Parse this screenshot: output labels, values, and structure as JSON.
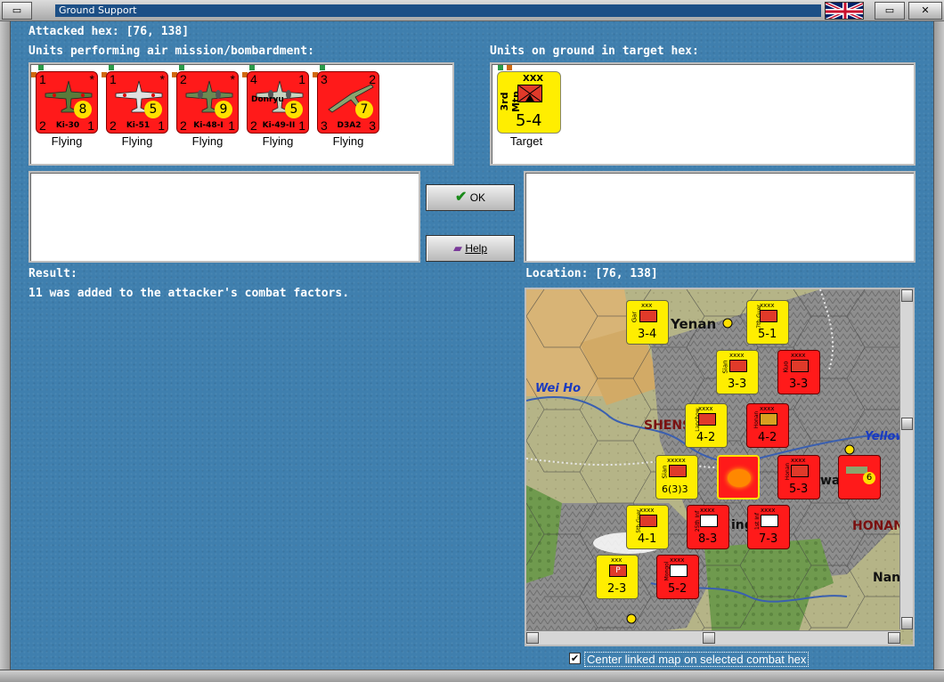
{
  "window": {
    "title": "Ground Support"
  },
  "attacked_hex_label": "Attacked hex:",
  "attacked_hex_value": "[76, 138]",
  "air_units_heading": "Units performing air mission/bombardment:",
  "ground_units_heading": "Units on ground in target hex:",
  "air_units": [
    {
      "tl": "1",
      "tr": "*",
      "bl": "2",
      "br": "1",
      "model": "Ki-30",
      "factor": "8",
      "status": "Flying",
      "color": "#5a7a3a"
    },
    {
      "tl": "1",
      "tr": "*",
      "bl": "2",
      "br": "1",
      "model": "Ki-51",
      "factor": "5",
      "status": "Flying",
      "color": "#d8d8d8"
    },
    {
      "tl": "2",
      "tr": "*",
      "bl": "2",
      "br": "1",
      "model": "Ki-48-I",
      "factor": "9",
      "status": "Flying",
      "color": "#6c8a52"
    },
    {
      "tl": "4",
      "tr": "1",
      "bl": "2",
      "br": "1",
      "model": "Ki-49-II",
      "factor": "5",
      "status": "Flying",
      "sub": "Donryu",
      "color": "#c8d4c0"
    },
    {
      "tl": "3",
      "tr": "2",
      "bl": "3",
      "br": "3",
      "model": "D3A2",
      "factor": "7",
      "status": "Flying",
      "color": "#8aa46e"
    }
  ],
  "ground_unit": {
    "size": "XXX",
    "name": "3rd Mtn",
    "strength": "5-4",
    "status": "Target"
  },
  "buttons": {
    "ok": "OK",
    "help": "Help"
  },
  "result_heading": "Result:",
  "result_text": "11 was added to the attacker's combat factors.",
  "location_label": "Location:",
  "location_value": "[76, 138]",
  "map": {
    "labels": [
      "Yenan",
      "Wei Ho",
      "SHENSI",
      "Yellow",
      "HONAN",
      "Nan",
      "wa",
      "ing"
    ],
    "counters": [
      {
        "side": "axis",
        "size": "xxx",
        "name": "Gar",
        "str": "3-4"
      },
      {
        "side": "axis",
        "size": "xxxx",
        "name": "7th Guer",
        "str": "5-1"
      },
      {
        "side": "axis",
        "size": "xxxx",
        "name": "Sian",
        "str": "3-3"
      },
      {
        "side": "enemy",
        "size": "xxxx",
        "name": "Kuo",
        "str": "3-3"
      },
      {
        "side": "axis",
        "size": "xxxx",
        "name": "Lanchow",
        "str": "4-2"
      },
      {
        "side": "enemy",
        "size": "xxxx",
        "name": "Honan",
        "str": "4-2"
      },
      {
        "side": "axis",
        "size": "xxxxx",
        "name": "Sian",
        "str": "6(3)3"
      },
      {
        "side": "enemy",
        "size": "",
        "name": "",
        "str": ""
      },
      {
        "side": "enemy",
        "size": "xxxx",
        "name": "Honan",
        "str": "5-3"
      },
      {
        "side": "enemy",
        "size": "",
        "name": "",
        "str": "6"
      },
      {
        "side": "axis",
        "size": "xxxx",
        "name": "5th Guer",
        "str": "4-1"
      },
      {
        "side": "enemy",
        "size": "xxxx",
        "name": "25th Inf",
        "str": "8-3"
      },
      {
        "side": "enemy",
        "size": "xxxx",
        "name": "1st Inf",
        "str": "7-3"
      },
      {
        "side": "axis",
        "size": "xxx",
        "name": "P",
        "str": "2-3"
      },
      {
        "side": "enemy",
        "size": "xxxx",
        "name": "Mongol",
        "str": "5-2"
      }
    ]
  },
  "checkbox": {
    "label": "Center linked map on selected combat hex",
    "checked": "✔"
  }
}
